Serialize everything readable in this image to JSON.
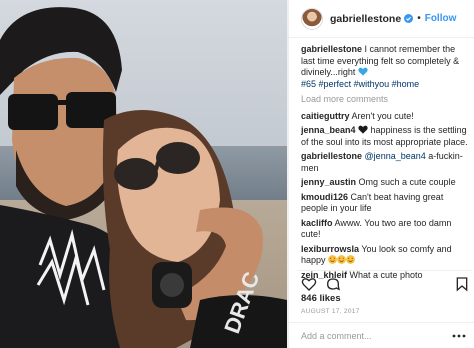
{
  "post": {
    "username": "gabriellestone",
    "follow_label": "Follow",
    "separator": "•",
    "caption_user": "gabriellestone",
    "caption_text": " I cannot remember the last time everything felt so completely & divinely...right ",
    "hashtags": [
      "#65",
      "#perfect",
      "#withyou",
      "#home"
    ],
    "load_more": "Load more comments",
    "comments": [
      {
        "user": "caitieguttry",
        "text": " Aren't you cute!"
      },
      {
        "user": "jenna_bean4",
        "text": " happiness is the settling of the soul into its most appropriate place."
      },
      {
        "user": "gabriellestone",
        "mention": "@jenna_bean4",
        "text": " a-fuckin-men"
      },
      {
        "user": "jenny_austin",
        "text": " Omg such a cute couple"
      },
      {
        "user": "kmoudi126",
        "text": " Can't beat having great people in your life"
      },
      {
        "user": "kacliffo",
        "text": " Awww. You two are too damn cute!"
      },
      {
        "user": "lexiburrowsla",
        "text": " You look so comfy and happy "
      },
      {
        "user": "zein_khleif",
        "text": " What a cute photo"
      }
    ],
    "likes": "846 likes",
    "date": "AUGUST 17, 2017",
    "add_comment_placeholder": "Add a comment..."
  },
  "icons": {
    "verified": "verified-badge-icon",
    "heart": "heart-icon",
    "comment": "comment-icon",
    "bookmark": "bookmark-icon",
    "more": "more-options-icon"
  },
  "colors": {
    "follow": "#3897f0",
    "hashtag": "#003569",
    "muted": "#999999",
    "heart_emoji": "#3aa8e0"
  }
}
